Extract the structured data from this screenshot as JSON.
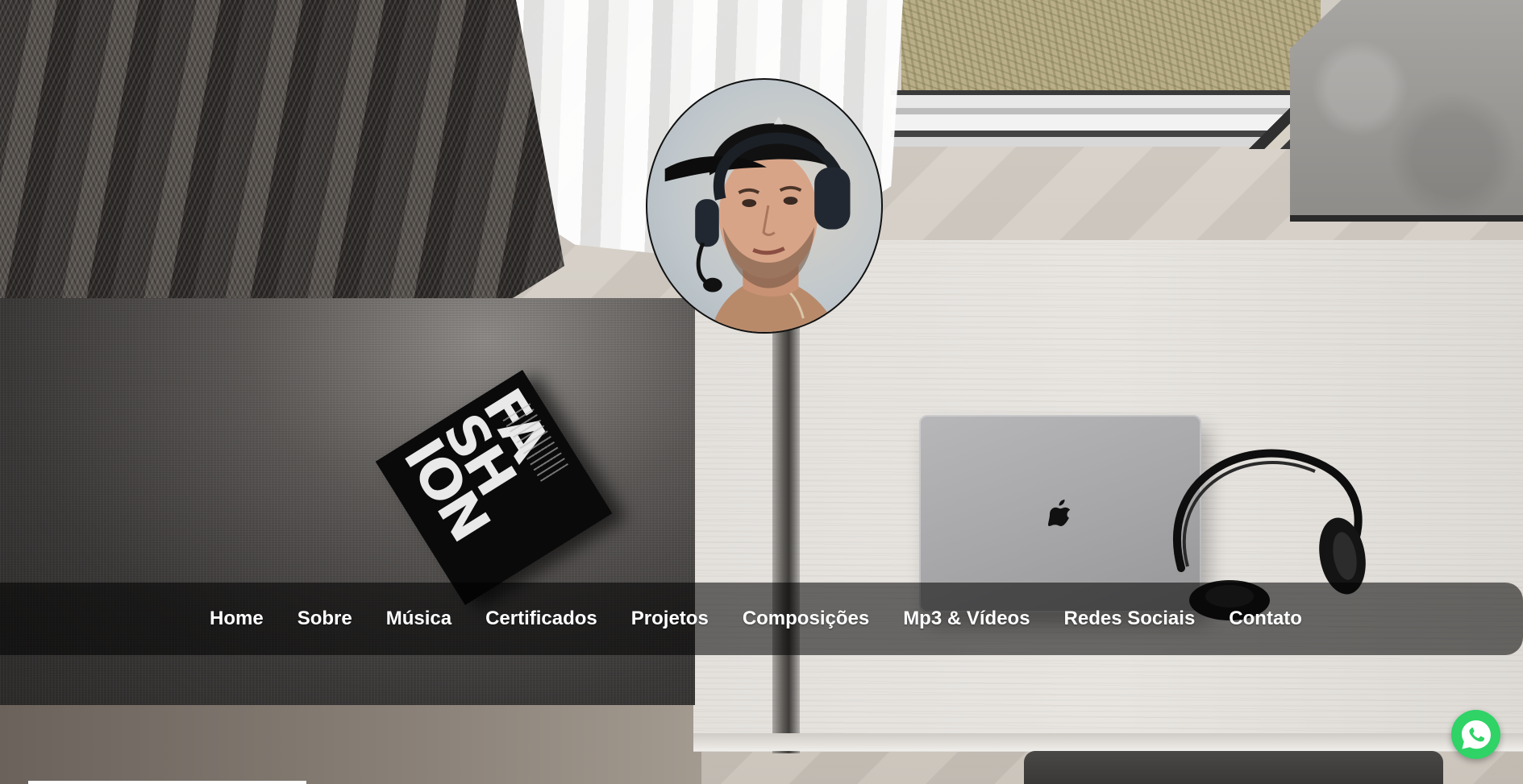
{
  "background": {
    "book_title": "FASHION"
  },
  "profile": {
    "avatar_icon": "profile-photo"
  },
  "nav": {
    "items": [
      {
        "label": "Home"
      },
      {
        "label": "Sobre"
      },
      {
        "label": "Música"
      },
      {
        "label": "Certificados"
      },
      {
        "label": "Projetos"
      },
      {
        "label": "Composições"
      },
      {
        "label": "Mp3 & Vídeos"
      },
      {
        "label": "Redes Sociais"
      },
      {
        "label": "Contato"
      }
    ]
  },
  "whatsapp": {
    "icon": "whatsapp-icon",
    "color": "#2fd366"
  },
  "colors": {
    "nav_text": "#ffffff",
    "nav_background": "rgba(0,0,0,0.55)"
  }
}
